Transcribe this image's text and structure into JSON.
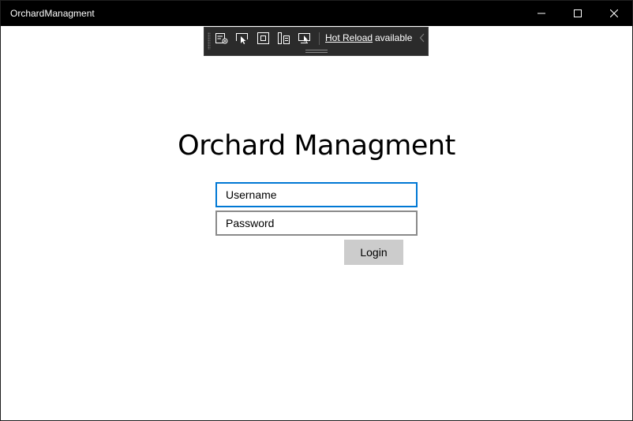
{
  "window": {
    "title": "OrchardManagment",
    "controls": {
      "minimize_icon": "minimize-icon",
      "maximize_icon": "maximize-icon",
      "close_icon": "close-icon"
    }
  },
  "dev_toolbar": {
    "tools": [
      "live-visual-tree-icon",
      "select-element-icon",
      "display-layout-adorners-icon",
      "track-focus-icon",
      "binding-failures-icon"
    ],
    "hot_reload_link": "Hot Reload",
    "hot_reload_status": "available",
    "collapse_icon": "chevron-left-icon"
  },
  "login": {
    "heading": "Orchard Managment",
    "username_placeholder": "Username",
    "password_placeholder": "Password",
    "login_label": "Login"
  },
  "colors": {
    "titlebar": "#000000",
    "focus_border": "#0078d4",
    "field_border": "#8a8a8a",
    "button_bg": "#cccccc",
    "toolbar_bg": "#2b2b2b"
  }
}
